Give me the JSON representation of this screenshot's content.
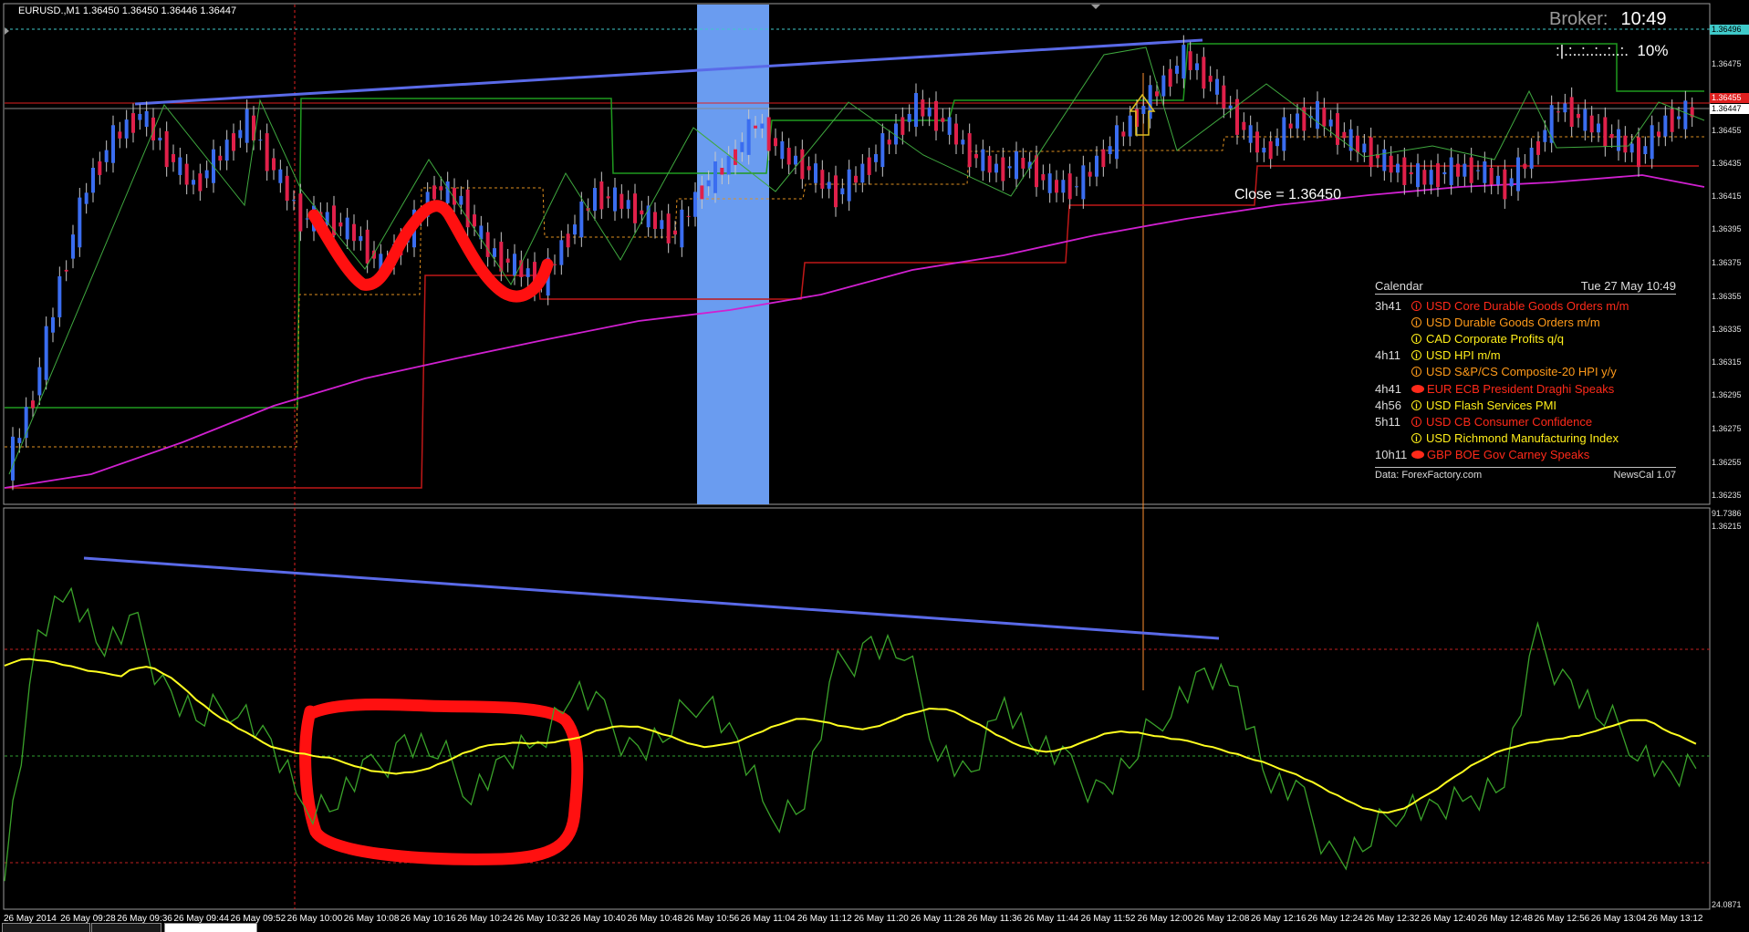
{
  "window": {
    "symbol_info": "EURUSD.,M1  1.36450 1.36450 1.36446 1.36447"
  },
  "overlay": {
    "broker_label": "Broker:",
    "broker_time": "10:49",
    "progress_text": ":|.:..:..:..:..:.  10%",
    "close_text": "Close = 1.36450"
  },
  "calendar": {
    "title": "Calendar",
    "date": "Tue 27 May 10:49",
    "events": [
      {
        "time": "3h41",
        "icon": "info-icon",
        "text": "USD Core Durable Goods Orders m/m",
        "color": "#ff2a1a"
      },
      {
        "time": "",
        "icon": "info-icon",
        "text": "USD Durable Goods Orders m/m",
        "color": "#ff9a1a"
      },
      {
        "time": "",
        "icon": "info-icon",
        "text": "CAD Corporate Profits q/q",
        "color": "#ffee1a"
      },
      {
        "time": "4h11",
        "icon": "info-icon",
        "text": "USD HPI m/m",
        "color": "#ffee1a"
      },
      {
        "time": "",
        "icon": "info-icon",
        "text": "USD S&P/CS Composite-20 HPI y/y",
        "color": "#ff9a1a"
      },
      {
        "time": "4h41",
        "icon": "speech-icon",
        "text": "EUR ECB President Draghi Speaks",
        "color": "#ff2a1a"
      },
      {
        "time": "4h56",
        "icon": "info-icon",
        "text": "USD Flash Services PMI",
        "color": "#ffee1a"
      },
      {
        "time": "5h11",
        "icon": "info-icon",
        "text": "USD CB Consumer Confidence",
        "color": "#ff2a1a"
      },
      {
        "time": "",
        "icon": "info-icon",
        "text": "USD Richmond Manufacturing Index",
        "color": "#ffee1a"
      },
      {
        "time": "10h11",
        "icon": "speech-icon",
        "text": "GBP BOE Gov Carney Speaks",
        "color": "#ff2a1a"
      }
    ],
    "source": "Data: ForexFactory.com",
    "version": "NewsCal 1.07"
  },
  "price_axis": {
    "labels": [
      "1.36475",
      "1.36455",
      "1.36435",
      "1.36415",
      "1.36395",
      "1.36375",
      "1.36355",
      "1.36335",
      "1.36315",
      "1.36295",
      "1.36275",
      "1.36255",
      "1.36235",
      "1.36215"
    ],
    "tag_top": "1.36496",
    "tag_mid": "1.36455",
    "tag_bid": "1.36447",
    "color_top": "#3fc9c9",
    "color_mid": "#e02020",
    "color_bid": "#ffffff"
  },
  "osc_axis": {
    "max": "91.7386",
    "min": "24.0871"
  },
  "time_axis": {
    "labels": [
      "26 May 2014",
      "26 May 09:28",
      "26 May 09:36",
      "26 May 09:44",
      "26 May 09:52",
      "26 May 10:00",
      "26 May 10:08",
      "26 May 10:16",
      "26 May 10:24",
      "26 May 10:32",
      "26 May 10:40",
      "26 May 10:48",
      "26 May 10:56",
      "26 May 11:04",
      "26 May 11:12",
      "26 May 11:20",
      "26 May 11:28",
      "26 May 11:36",
      "26 May 11:44",
      "26 May 11:52",
      "26 May 12:00",
      "26 May 12:08",
      "26 May 12:16",
      "26 May 12:24",
      "26 May 12:32",
      "26 May 12:40",
      "26 May 12:48",
      "26 May 12:56",
      "26 May 13:04",
      "26 May 13:12"
    ]
  },
  "colors": {
    "bull": "#3a6df0",
    "bear": "#e0204a",
    "ma": "#d020d0",
    "zigzag": "#3fa83f",
    "trend": "#5a6ae8",
    "highlight": "#6a9cf0",
    "annotation": "#ff1010",
    "signal": "#ffff20",
    "osc": "#3aa22a"
  },
  "chart_data": {
    "type": "line",
    "title": "EURUSD.,M1",
    "series": [
      {
        "name": "EURUSD.,M1",
        "values": [
          1.36225,
          1.3627,
          1.3634,
          1.364,
          1.3643,
          1.36445,
          1.3642,
          1.364,
          1.3642,
          1.3644,
          1.3641,
          1.3638,
          1.3638,
          1.3637,
          1.3635,
          1.3637,
          1.364,
          1.3639,
          1.3636,
          1.3635,
          1.3634,
          1.3637,
          1.36395,
          1.3639,
          1.3638,
          1.3637,
          1.364,
          1.36415,
          1.3644,
          1.3642,
          1.3641,
          1.36395,
          1.3641,
          1.3643,
          1.3645,
          1.3644,
          1.3642,
          1.3641,
          1.36415,
          1.364,
          1.364,
          1.3642,
          1.3644,
          1.3646,
          1.3648,
          1.36465,
          1.3644,
          1.3642,
          1.3644,
          1.36445,
          1.3643,
          1.3642,
          1.3641,
          1.36405,
          1.3641,
          1.3641,
          1.364,
          1.3642,
          1.3645,
          1.3644,
          1.3643,
          1.3642,
          1.3644,
          1.36447
        ]
      },
      {
        "name": "Oscillator",
        "values": [
          30,
          70,
          80,
          70,
          72,
          60,
          56,
          60,
          50,
          40,
          42,
          46,
          52,
          50,
          44,
          47,
          52,
          62,
          56,
          50,
          54,
          62,
          50,
          38,
          42,
          65,
          70,
          68,
          52,
          44,
          60,
          52,
          46,
          43,
          50,
          60,
          63,
          62,
          45,
          40,
          30,
          34,
          42,
          38,
          42,
          46,
          70,
          62,
          56,
          52,
          44,
          48
        ]
      }
    ]
  }
}
